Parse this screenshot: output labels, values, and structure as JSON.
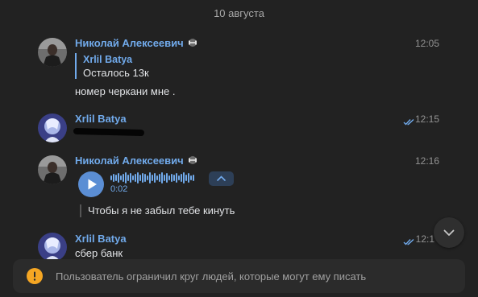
{
  "date_separator": "10 августа",
  "messages": [
    {
      "author": "Николай Алексеевич",
      "time": "12:05",
      "badge_icon": "dumbbell-icon",
      "reply": {
        "author": "Xrlil Batya",
        "text": "Осталось 13к"
      },
      "text": "номер черкани мне ."
    },
    {
      "author": "Xrlil Batya",
      "time": "12:15",
      "status_icon": "double-check-icon",
      "text_redacted": true
    },
    {
      "author": "Николай Алексеевич",
      "time": "12:16",
      "badge_icon": "dumbbell-icon",
      "voice": {
        "duration": "0:02"
      },
      "transcript": "Чтобы я не забыл тебе кинуть"
    },
    {
      "author": "Xrlil Batya",
      "time": "12:1",
      "status_icon": "double-check-icon",
      "text": "сбер банк"
    }
  ],
  "notice": {
    "icon": "info-icon",
    "text": "Пользователь ограничил круг людей, которые могут ему писать"
  },
  "colors": {
    "background": "#222222",
    "accent": "#71aaeb",
    "notice_icon": "#f5a623"
  }
}
